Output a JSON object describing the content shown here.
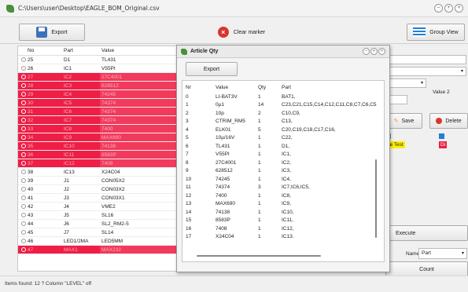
{
  "window": {
    "title": "C:\\Users\\user\\Desktop\\EAGLE_BOM_Original.csv"
  },
  "toolbar": {
    "export_label": "Export",
    "clear_marker_label": "Clear marker",
    "group_view_label": "Group View"
  },
  "main_table": {
    "headers": [
      "No",
      "Part",
      "Value"
    ],
    "rows": [
      {
        "no": "25",
        "part": "D1",
        "value": "TL431",
        "marked": false
      },
      {
        "no": "26",
        "part": "IC1",
        "value": "V55PI",
        "marked": false
      },
      {
        "no": "27",
        "part": "IC2",
        "value": "27C4001",
        "marked": true
      },
      {
        "no": "28",
        "part": "IC3",
        "value": "628512",
        "marked": true
      },
      {
        "no": "29",
        "part": "IC4",
        "value": "74245",
        "marked": true
      },
      {
        "no": "30",
        "part": "IC5",
        "value": "74374",
        "marked": true
      },
      {
        "no": "31",
        "part": "IC6",
        "value": "74374",
        "marked": true
      },
      {
        "no": "32",
        "part": "IC7",
        "value": "74374",
        "marked": true
      },
      {
        "no": "33",
        "part": "IC8",
        "value": "7400",
        "marked": true
      },
      {
        "no": "34",
        "part": "IC9",
        "value": "MAX690",
        "marked": true
      },
      {
        "no": "35",
        "part": "IC10",
        "value": "74138",
        "marked": true
      },
      {
        "no": "36",
        "part": "IC11",
        "value": "8583P",
        "marked": true
      },
      {
        "no": "37",
        "part": "IC12",
        "value": "7408",
        "marked": true
      },
      {
        "no": "38",
        "part": "IC13",
        "value": "X24C04",
        "marked": false
      },
      {
        "no": "39",
        "part": "J1",
        "value": "CON05X2",
        "marked": false
      },
      {
        "no": "40",
        "part": "J2",
        "value": "CON03X2",
        "marked": false
      },
      {
        "no": "41",
        "part": "J3",
        "value": "CON03X1",
        "marked": false
      },
      {
        "no": "42",
        "part": "J4",
        "value": "VME2",
        "marked": false
      },
      {
        "no": "43",
        "part": "J5",
        "value": "SL16",
        "marked": false
      },
      {
        "no": "44",
        "part": "J6",
        "value": "SL2_RM2-5",
        "marked": false
      },
      {
        "no": "45",
        "part": "J7",
        "value": "SL14",
        "marked": false
      },
      {
        "no": "46",
        "part": "LED1/2MA",
        "value": "LED5MM",
        "marked": false
      },
      {
        "no": "47",
        "part": "MAX1",
        "value": "MAX232",
        "marked": true
      }
    ]
  },
  "dialog": {
    "title": "Article Qty",
    "export_label": "Export",
    "headers": [
      "Nr",
      "Value",
      "Qty",
      "Part"
    ],
    "rows": [
      {
        "nr": "0",
        "value": "LI-BAT3V",
        "qty": "1",
        "part": "BAT1,"
      },
      {
        "nr": "1",
        "value": "0µ1",
        "qty": "14",
        "part": "C23,C21,C15,C14,C12,C11,C8,C7,C6,C5"
      },
      {
        "nr": "2",
        "value": "10p",
        "qty": "2",
        "part": "C10,C9,"
      },
      {
        "nr": "3",
        "value": "CTRIM_RM5",
        "qty": "1",
        "part": "C13,"
      },
      {
        "nr": "4",
        "value": "ELK01",
        "qty": "5",
        "part": "C20,C19,C18,C17,C16,"
      },
      {
        "nr": "5",
        "value": "10µ/16V",
        "qty": "1",
        "part": "C22,"
      },
      {
        "nr": "6",
        "value": "TL431",
        "qty": "1",
        "part": "D1,"
      },
      {
        "nr": "7",
        "value": "V55PI",
        "qty": "1",
        "part": "IC1,"
      },
      {
        "nr": "8",
        "value": "27C4001",
        "qty": "1",
        "part": "IC2,"
      },
      {
        "nr": "9",
        "value": "628512",
        "qty": "1",
        "part": "IC3,"
      },
      {
        "nr": "10",
        "value": "74245",
        "qty": "1",
        "part": "IC4,"
      },
      {
        "nr": "11",
        "value": "74374",
        "qty": "3",
        "part": "IC7,IC6,IC5,"
      },
      {
        "nr": "12",
        "value": "7400",
        "qty": "1",
        "part": "IC8,"
      },
      {
        "nr": "13",
        "value": "MAX690",
        "qty": "1",
        "part": "IC9,"
      },
      {
        "nr": "14",
        "value": "74138",
        "qty": "1",
        "part": "IC10,"
      },
      {
        "nr": "15",
        "value": "8583P",
        "qty": "1",
        "part": "IC11,"
      },
      {
        "nr": "16",
        "value": "7408",
        "qty": "1",
        "part": "IC12,"
      },
      {
        "nr": "17",
        "value": "X24C04",
        "qty": "1",
        "part": "IC13."
      }
    ]
  },
  "right_panel": {
    "value2_label": "Value 2",
    "save_label": "Save",
    "delete_label": "Delete",
    "tag_text": "ge Test",
    "tag_text2": "Di",
    "execute_label": "Execute",
    "name_label": "Name",
    "name_select": "Part",
    "count_label": "Count"
  },
  "status": {
    "text": "Items found: 12   ?   Column \"LEVEL\" off"
  },
  "colors": {
    "marker": "#ee1e46",
    "accent": "#1e7fd8"
  }
}
